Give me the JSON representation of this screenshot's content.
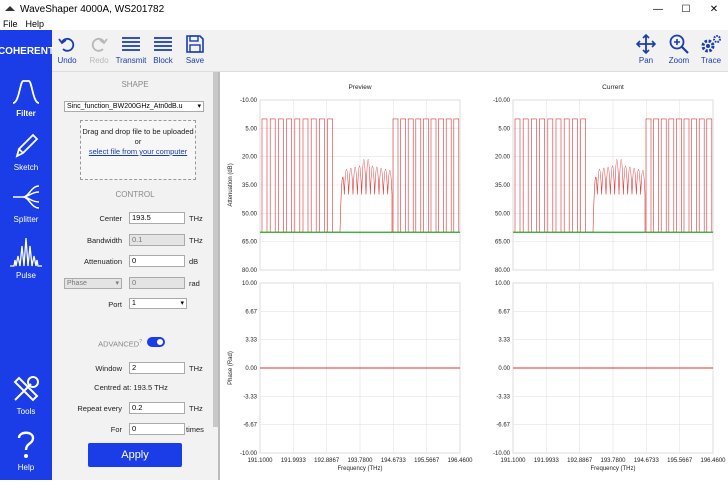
{
  "window": {
    "title": "WaveShaper 4000A, WS201782",
    "minimize": "—",
    "maximize": "☐",
    "close": "✕"
  },
  "menu": {
    "file": "File",
    "help": "Help"
  },
  "brand": {
    "logo_text": "COHERENT",
    "color": "#1a3de8"
  },
  "toolbar": {
    "undo": "Undo",
    "redo": "Redo",
    "transmit": "Transmit",
    "block": "Block",
    "save": "Save",
    "pan": "Pan",
    "zoom": "Zoom",
    "trace": "Trace"
  },
  "sidenav": {
    "filter": "Filter",
    "sketch": "Sketch",
    "splitter": "Splitter",
    "pulse": "Pulse",
    "tools": "Tools",
    "help": "Help"
  },
  "shape": {
    "heading": "SHAPE",
    "selected_file": "Sinc_function_BW200GHz_Atn0dB.u",
    "drop_text": "Drag and drop file to be uploaded",
    "or": "or",
    "select_link": "select file from your computer"
  },
  "control": {
    "heading": "CONTROL",
    "center_label": "Center",
    "center_value": "193.5",
    "center_unit": "THz",
    "bandwidth_label": "Bandwidth",
    "bandwidth_value": "0.1",
    "bandwidth_unit": "THz",
    "attenuation_label": "Attenuation",
    "attenuation_value": "0",
    "attenuation_unit": "dB",
    "phase_select": "Phase",
    "phase_value": "0",
    "phase_unit": "rad",
    "port_label": "Port",
    "port_value": "1"
  },
  "advanced": {
    "label": "ADVANCED",
    "sup": "?",
    "enabled": true,
    "window_label": "Window",
    "window_value": "2",
    "window_unit": "THz",
    "centred_text": "Centred at: 193.5 THz",
    "repeat_label": "Repeat every",
    "repeat_value": "0.2",
    "repeat_unit": "THz",
    "for_label": "For",
    "for_value": "0",
    "for_unit": "times"
  },
  "apply_label": "Apply",
  "chart_data": [
    {
      "type": "line",
      "title": "Preview",
      "ylabel": "Attenuation (dB)",
      "ylim": [
        80,
        -10
      ],
      "yticks": [
        "-10.00",
        "5.00",
        "20.00",
        "35.00",
        "50.00",
        "65.00",
        "80.00"
      ],
      "series": [
        {
          "color": "#d33",
          "description": "Attenuation"
        },
        {
          "color": "#2a2",
          "description": "Threshold"
        }
      ]
    },
    {
      "type": "line",
      "title": "Current",
      "ylabel": "",
      "ylim": [
        80,
        -10
      ],
      "yticks": [
        "-10.00",
        "5.00",
        "20.00",
        "35.00",
        "50.00",
        "65.00",
        "80.00"
      ]
    },
    {
      "type": "line",
      "title": "",
      "ylabel": "Phase (Rad)",
      "xlabel": "Frequency (THz)",
      "ylim": [
        -10,
        10
      ],
      "yticks": [
        "10.00",
        "6.67",
        "3.33",
        "0.00",
        "-3.33",
        "-6.67",
        "-10.00"
      ],
      "xticks": [
        "191.1000",
        "191.9933",
        "192.8867",
        "193.7800",
        "194.6733",
        "195.5667",
        "196.4600"
      ],
      "series": [
        {
          "color": "#d33",
          "values_constant": 0
        }
      ]
    },
    {
      "type": "line",
      "title": "",
      "ylabel": "",
      "xlabel": "Frequency (THz)",
      "ylim": [
        -10,
        10
      ],
      "yticks": [
        "10.00",
        "6.67",
        "3.33",
        "0.00",
        "-3.33",
        "-6.67",
        "-10.00"
      ],
      "xticks": [
        "191.1000",
        "191.9933",
        "192.8867",
        "193.7800",
        "194.6733",
        "195.5667",
        "196.4600"
      ],
      "series": [
        {
          "color": "#d33",
          "values_constant": 0
        }
      ]
    }
  ]
}
